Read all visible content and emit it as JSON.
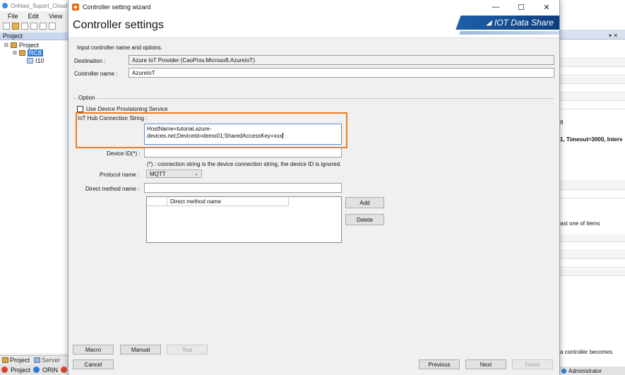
{
  "bg_app": {
    "title": "OnNavi_Suport_Cloud",
    "menu": [
      "File",
      "Edit",
      "View"
    ],
    "project_header": "Project",
    "tree": {
      "root": "Project",
      "controller": "RC8",
      "child": "I10"
    },
    "bottom_tabs": [
      "Project",
      "Server"
    ],
    "status": [
      "Project",
      "ORiN"
    ],
    "right_panel": {
      "line1": "8",
      "line2": "1, Timeout=3000, Interv",
      "line3": "ast one of items",
      "line4": "a controller becomes",
      "status_user": "Administrator"
    }
  },
  "dialog": {
    "window_title": "Controller setting wizard",
    "header_title": "Controller settings",
    "brand": "IOT Data Share",
    "intro": "Input controller name and options.",
    "destination_label": "Destination :",
    "destination_value": "Azure IoT Provider (CaoProv.Microsoft.AzureIoT)",
    "controller_name_label": "Controller name :",
    "controller_name_value": "AzureIoT",
    "option_legend": "Option",
    "use_dps_label": "Use Device Provisioning Service",
    "conn_label": "IoT Hub Connection String :",
    "conn_value": "HostName=tutorial.azure-devices.net;DeviceId=demo01;SharedAccessKey=xxx",
    "device_id_label": "Device ID(*) :",
    "device_id_value": "",
    "note": "(*) : connection string is the device connection string, the device ID is ignored.",
    "protocol_label": "Protocol name :",
    "protocol_value": "MQTT",
    "direct_method_label": "Direct method name :",
    "direct_method_value": "",
    "list_header": "Direct method name",
    "add_label": "Add",
    "delete_label": "Delete",
    "macro_label": "Macro",
    "manual_label": "Manual",
    "test_label": "Test",
    "cancel_label": "Cancel",
    "previous_label": "Previous",
    "next_label": "Next",
    "finish_label": "Finish"
  },
  "colors": {
    "highlight": "#f07c1e",
    "brand": "#0e3e7d",
    "selection": "#2a7cd6"
  }
}
